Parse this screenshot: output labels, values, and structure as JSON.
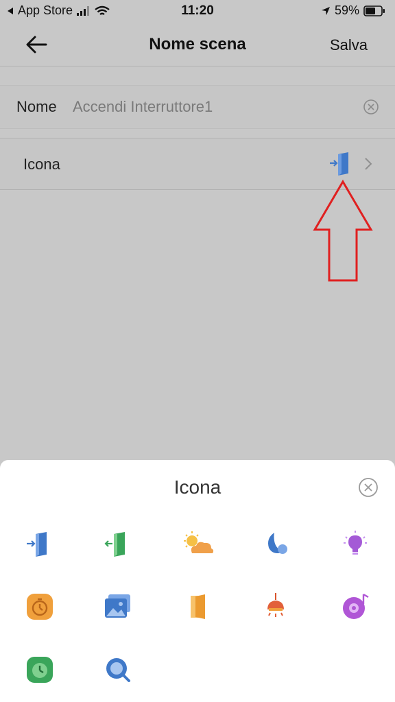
{
  "status_bar": {
    "back_app": "App Store",
    "time": "11:20",
    "battery": "59%"
  },
  "nav": {
    "title": "Nome scena",
    "save_label": "Salva"
  },
  "name_row": {
    "label": "Nome",
    "value": "Accendi Interruttore1"
  },
  "icon_row": {
    "label": "Icona",
    "selected_icon": "door-enter-blue-icon"
  },
  "sheet": {
    "title": "Icona",
    "icons": [
      "door-enter-blue-icon",
      "door-exit-green-icon",
      "sun-cloud-icon",
      "moon-night-icon",
      "light-bulb-icon",
      "stopwatch-icon",
      "photo-gallery-icon",
      "door-orange-icon",
      "ceiling-lamp-icon",
      "music-disc-icon",
      "alarm-clock-icon",
      "search-icon"
    ]
  },
  "colors": {
    "overlay": "#c8c8c8",
    "sheet": "#ffffff",
    "annotation_arrow": "#e02020"
  }
}
